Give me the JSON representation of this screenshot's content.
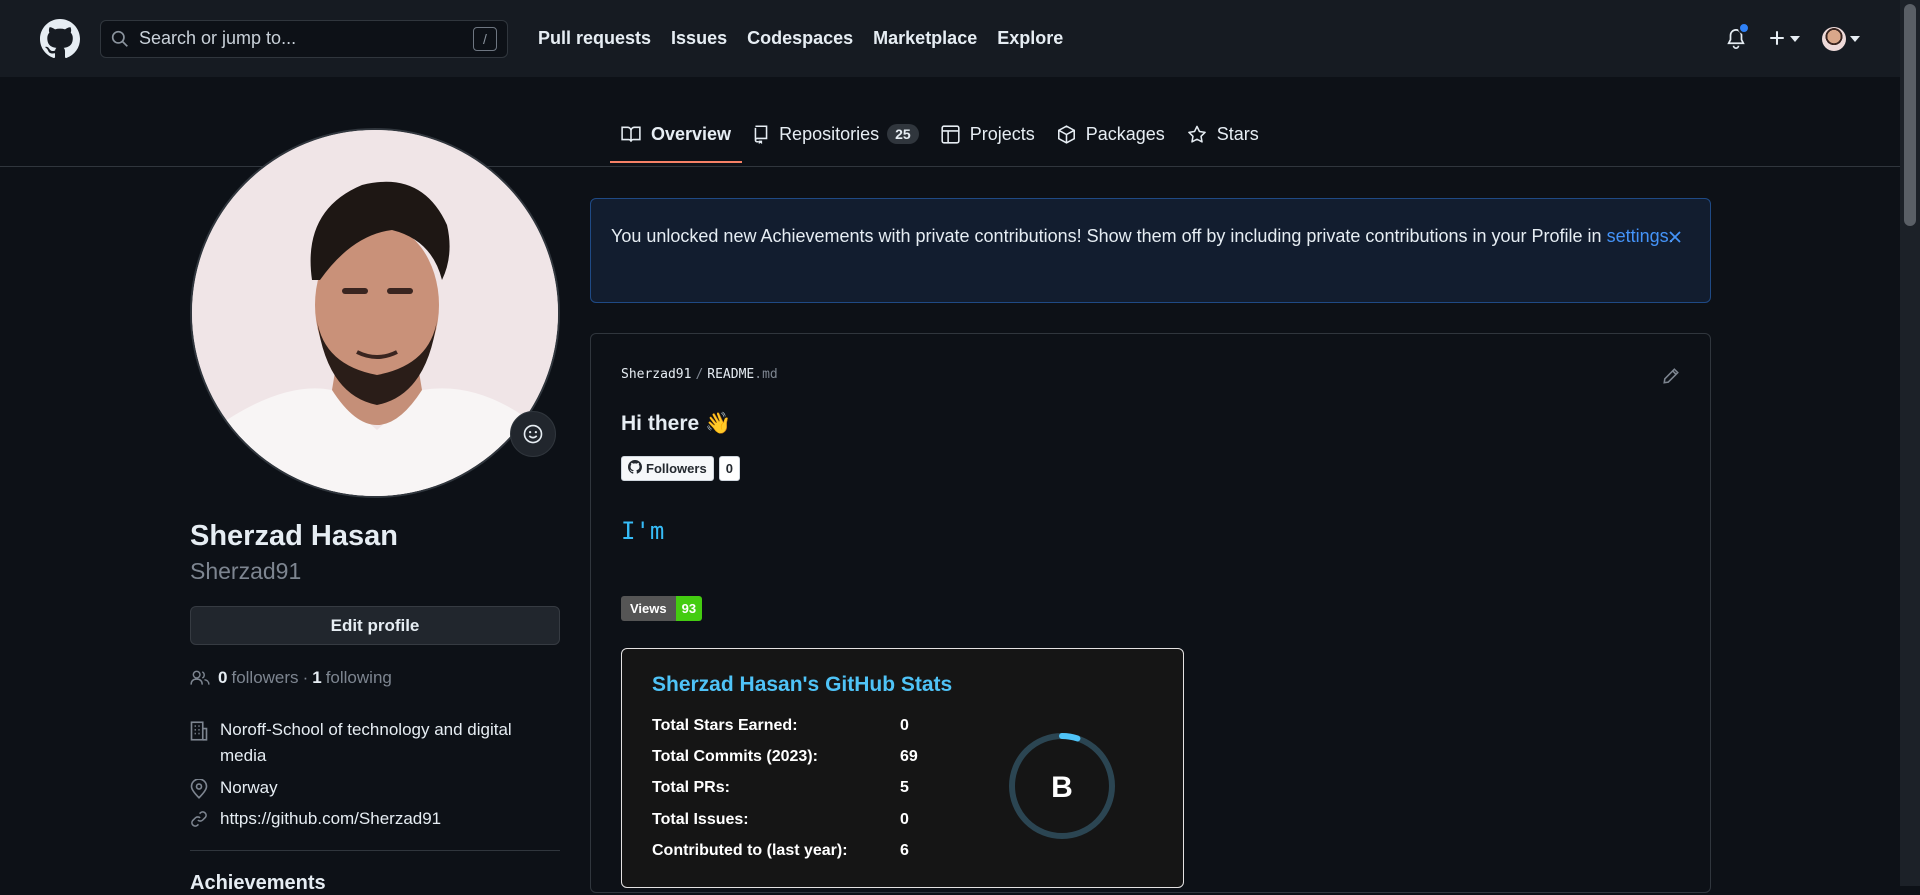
{
  "header": {
    "search_placeholder": "Search or jump to...",
    "search_shortcut": "/",
    "nav": [
      "Pull requests",
      "Issues",
      "Codespaces",
      "Marketplace",
      "Explore"
    ],
    "notification_color": "#2f81f7"
  },
  "tabs": [
    {
      "label": "Overview",
      "icon": "book-icon",
      "active": true
    },
    {
      "label": "Repositories",
      "icon": "repo-icon",
      "count": "25"
    },
    {
      "label": "Projects",
      "icon": "table-icon"
    },
    {
      "label": "Packages",
      "icon": "package-icon"
    },
    {
      "label": "Stars",
      "icon": "star-icon"
    }
  ],
  "profile": {
    "name": "Sherzad Hasan",
    "login": "Sherzad91",
    "edit_label": "Edit profile",
    "followers_count": "0",
    "followers_label": "followers",
    "separator": "·",
    "following_count": "1",
    "following_label": "following",
    "organization": "Noroff-School of technology and digital media",
    "location": "Norway",
    "website": "https://github.com/Sherzad91",
    "achievements_heading": "Achievements"
  },
  "flash": {
    "message": "You unlocked new Achievements with private contributions! Show them off by including private contributions in your Profile in ",
    "link": "settings",
    "suffix": "."
  },
  "readme": {
    "owner": "Sherzad91",
    "separator": "/",
    "file": "README",
    "ext": ".md",
    "greeting": "Hi there 👋",
    "followers_badge_label": "Followers",
    "followers_badge_count": "0",
    "typing_text": "I'm",
    "views_label": "Views",
    "views_count": "93",
    "views_color": "#44cc11"
  },
  "stats_card": {
    "title": "Sherzad Hasan's GitHub Stats",
    "rows": [
      {
        "label": "Total Stars Earned:",
        "value": "0"
      },
      {
        "label": "Total Commits (2023):",
        "value": "69"
      },
      {
        "label": "Total PRs:",
        "value": "5"
      },
      {
        "label": "Total Issues:",
        "value": "0"
      },
      {
        "label": "Contributed to (last year):",
        "value": "6"
      }
    ],
    "rank": "B",
    "rank_progress": 0.05,
    "accent_color": "#4fc3f7"
  }
}
